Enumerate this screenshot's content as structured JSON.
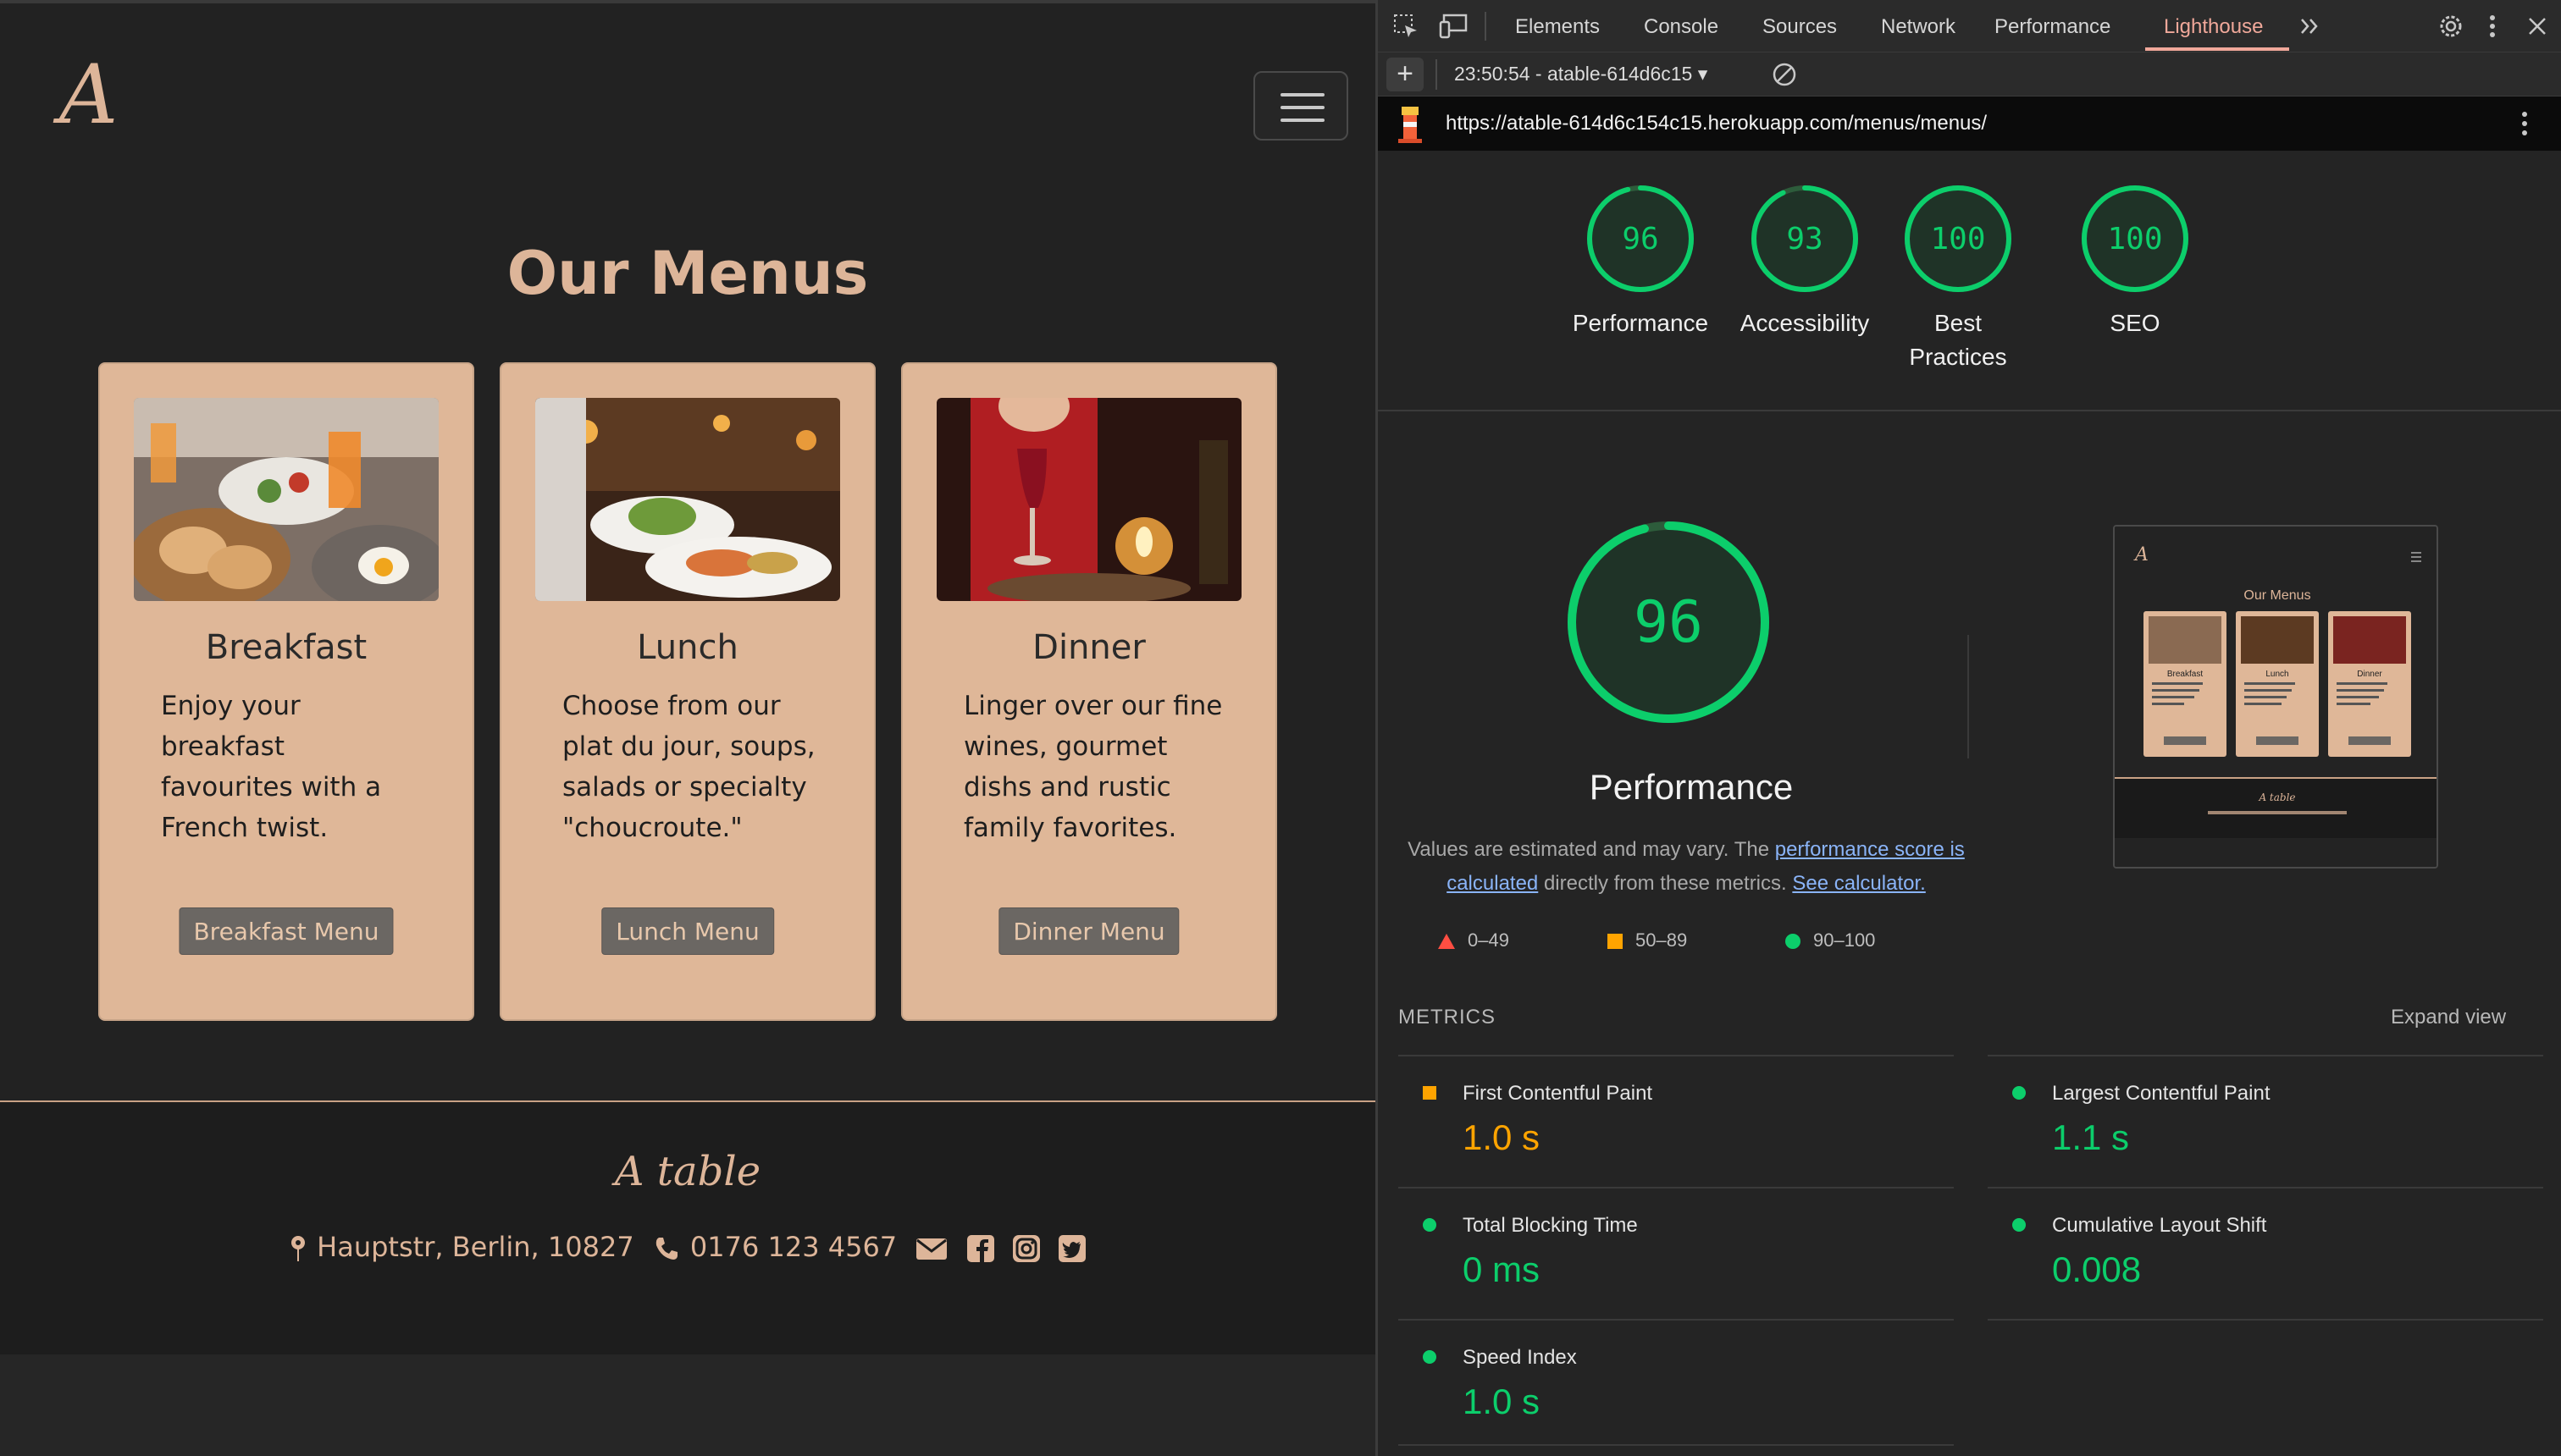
{
  "site": {
    "logo": "A",
    "title": "Our Menus",
    "cards": [
      {
        "title": "Breakfast",
        "description": "Enjoy your breakfast favourites with a French twist.",
        "button": "Breakfast Menu"
      },
      {
        "title": "Lunch",
        "description": "Choose from our plat du jour, soups, salads or specialty \"choucroute.\"",
        "button": "Lunch Menu"
      },
      {
        "title": "Dinner",
        "description": "Linger over our fine wines, gourmet dishs and rustic family favorites.",
        "button": "Dinner Menu"
      }
    ],
    "footer": {
      "brand": "A table",
      "address": "Hauptstr, Berlin, 10827",
      "phone": "0176 123 4567"
    }
  },
  "devtools": {
    "tabs": [
      "Elements",
      "Console",
      "Sources",
      "Network",
      "Performance",
      "Lighthouse"
    ],
    "active_tab": "Lighthouse",
    "report_label": "23:50:54 - atable-614d6c15",
    "url": "https://atable-614d6c154c15.herokuapp.com/menus/menus/",
    "scores": [
      {
        "label": "Performance",
        "value": 96
      },
      {
        "label": "Accessibility",
        "value": 93
      },
      {
        "label": "Best Practices",
        "value": 100
      },
      {
        "label": "SEO",
        "value": 100
      }
    ],
    "performance": {
      "score": "96",
      "score_value": 96,
      "title": "Performance",
      "disclaimer_pre": "Values are estimated and may vary. The ",
      "link_score": "performance score is calculated",
      "disclaimer_mid": " directly from these metrics. ",
      "link_calc": "See calculator.",
      "legend": [
        "0–49",
        "50–89",
        "90–100"
      ]
    },
    "thumbnail": {
      "title": "Our Menus",
      "cards": [
        "Breakfast",
        "Lunch",
        "Dinner"
      ],
      "footer_brand": "A table"
    },
    "metrics_heading": "METRICS",
    "expand_view": "Expand view",
    "metrics": [
      {
        "name": "First Contentful Paint",
        "value": "1.0 s",
        "status": "average"
      },
      {
        "name": "Largest Contentful Paint",
        "value": "1.1 s",
        "status": "pass"
      },
      {
        "name": "Total Blocking Time",
        "value": "0 ms",
        "status": "pass"
      },
      {
        "name": "Cumulative Layout Shift",
        "value": "0.008",
        "status": "pass"
      },
      {
        "name": "Speed Index",
        "value": "1.0 s",
        "status": "pass"
      }
    ],
    "colors": {
      "pass": "#0cce6b",
      "average": "#ffa400",
      "fail": "#ff4e42",
      "accent": "#f0a89a"
    }
  }
}
